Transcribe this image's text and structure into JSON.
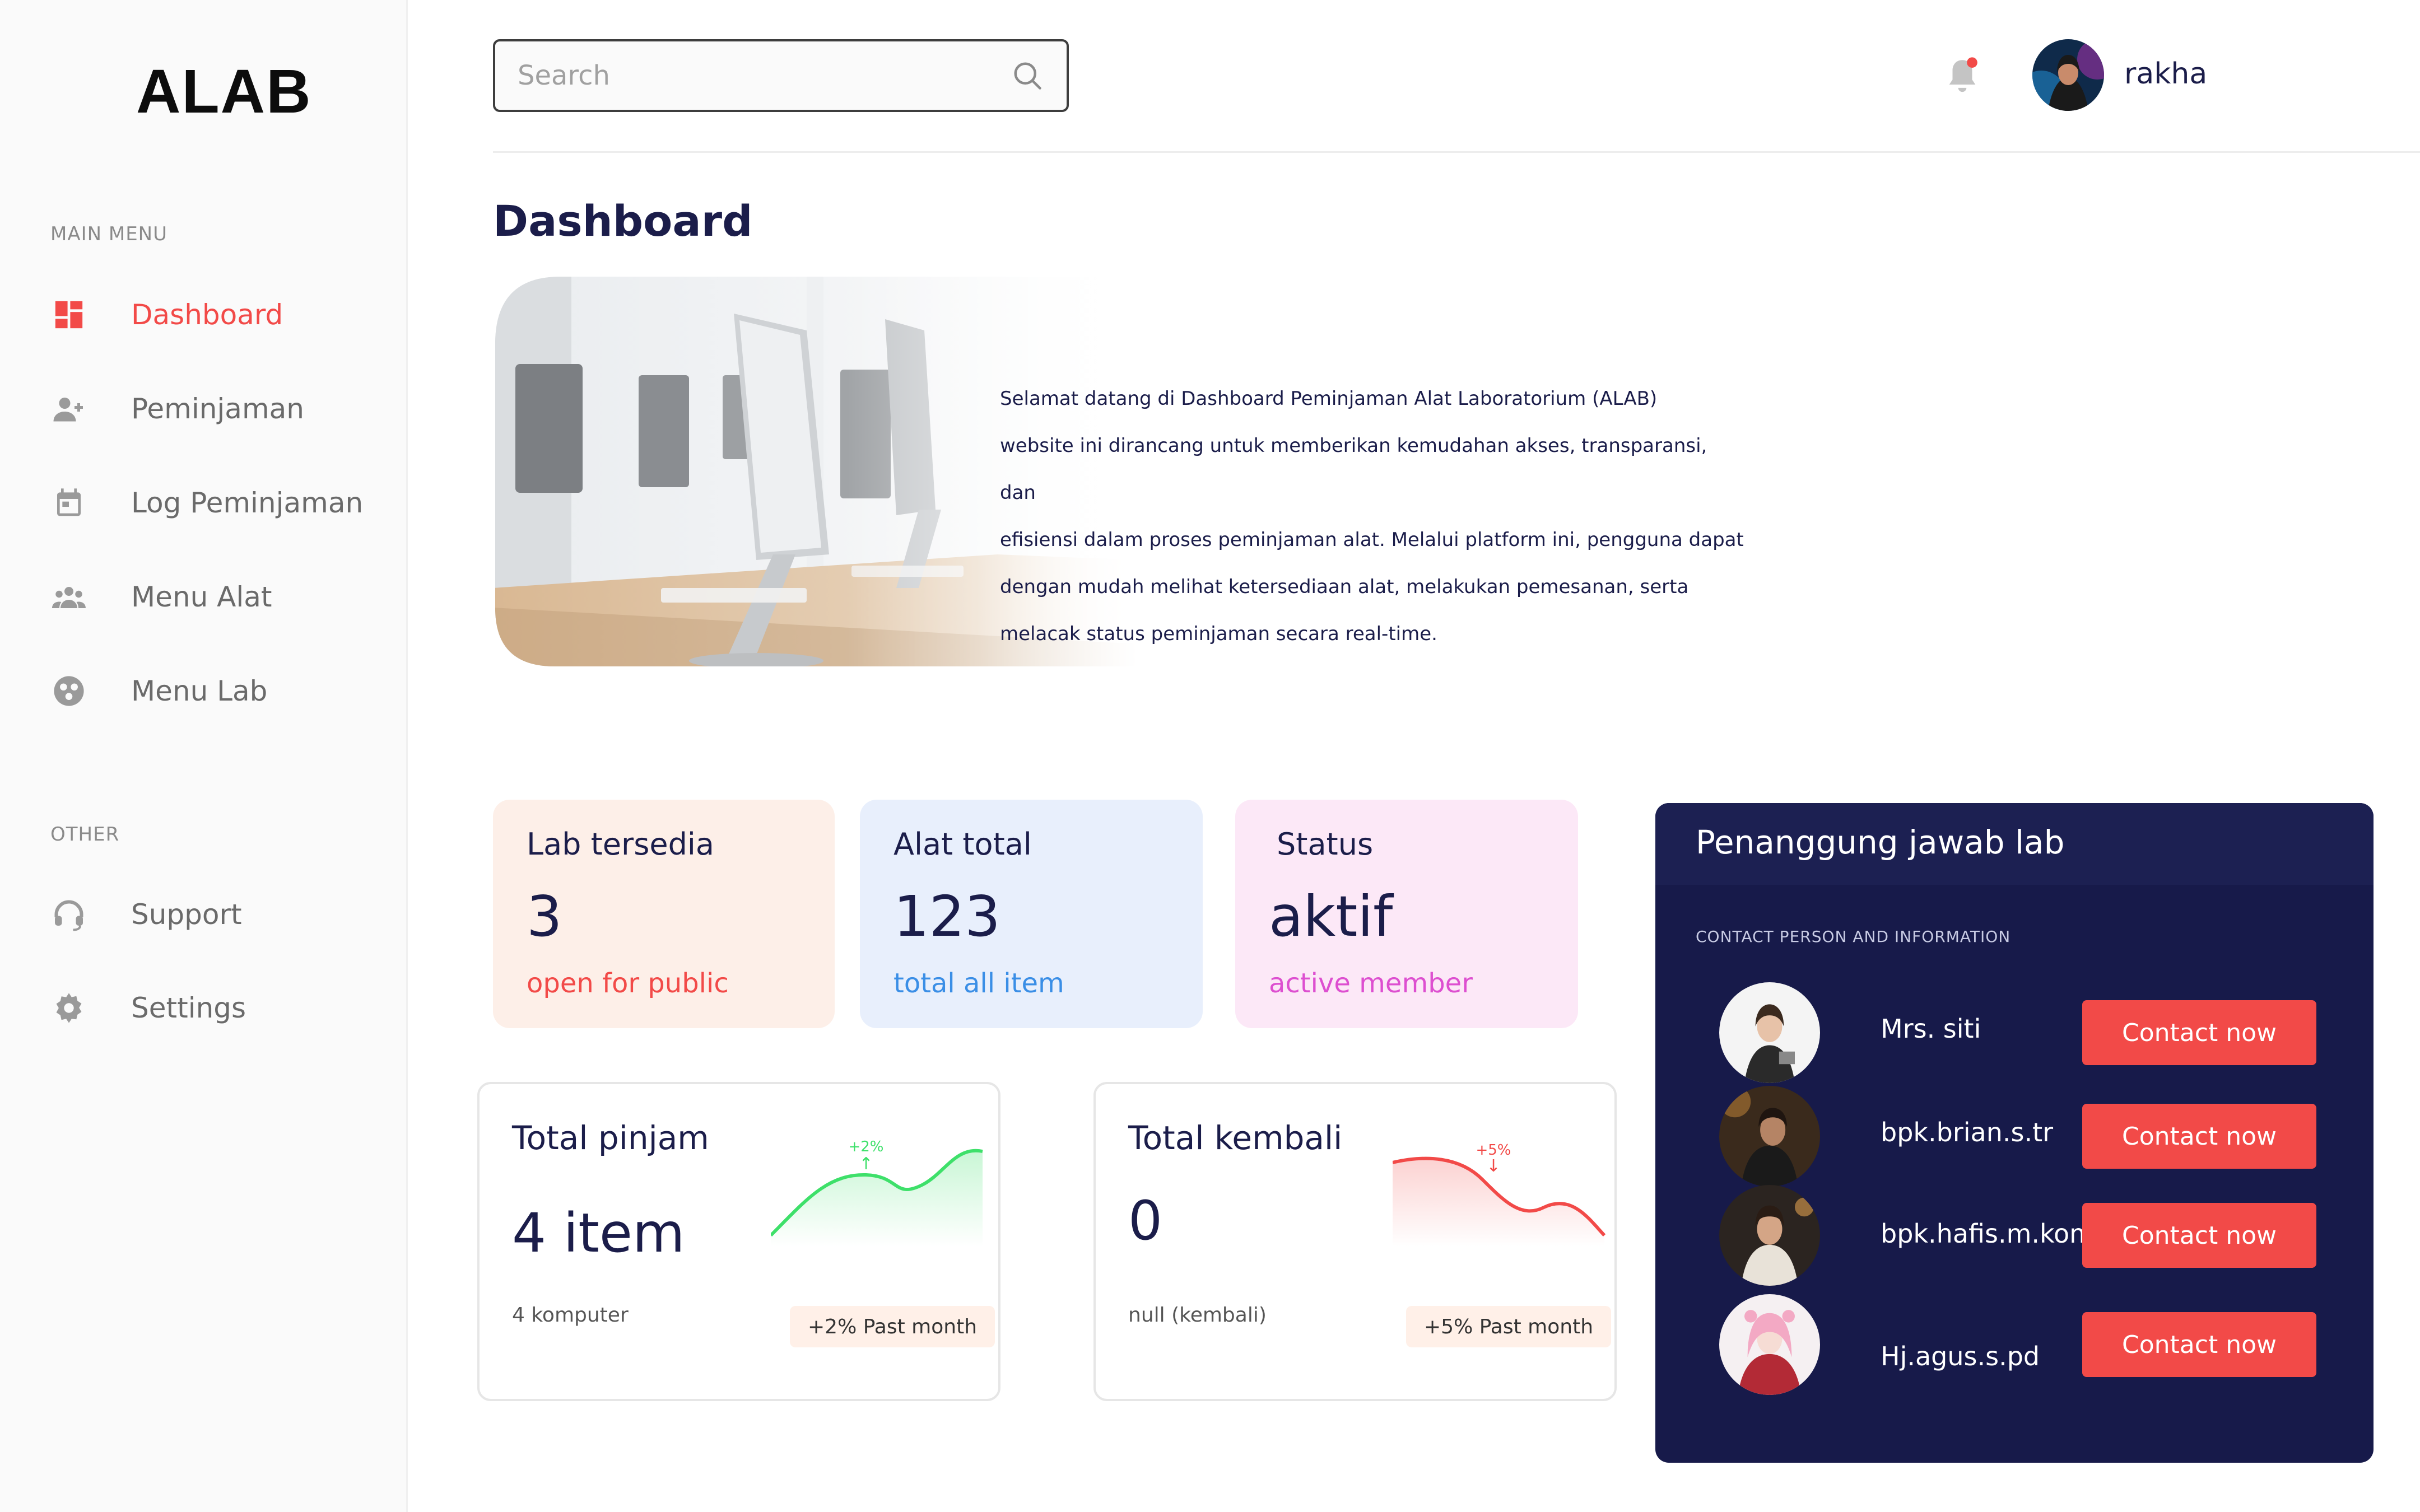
{
  "app": {
    "logo": "ALAB"
  },
  "sidebar": {
    "main_menu_label": "MAIN MENU",
    "main_items": [
      {
        "label": "Dashboard",
        "icon": "dashboard-icon",
        "active": true
      },
      {
        "label": "Peminjaman",
        "icon": "add-user-icon"
      },
      {
        "label": "Log Peminjaman",
        "icon": "calendar-icon"
      },
      {
        "label": "Menu Alat",
        "icon": "group-icon"
      },
      {
        "label": "Menu Lab",
        "icon": "lab-icon"
      }
    ],
    "other_label": "OTHER",
    "other_items": [
      {
        "label": "Support",
        "icon": "headset-icon"
      },
      {
        "label": "Settings",
        "icon": "gear-icon"
      }
    ]
  },
  "header": {
    "search_placeholder": "Search",
    "username": "rakha"
  },
  "main": {
    "title": "Dashboard",
    "hero_lines": [
      "Selamat datang di Dashboard Peminjaman Alat Laboratorium (ALAB)",
      "website ini dirancang untuk memberikan kemudahan akses, transparansi, dan",
      "efisiensi dalam proses peminjaman alat. Melalui platform ini, pengguna dapat",
      "dengan mudah melihat ketersediaan alat, melakukan pemesanan, serta",
      "melacak status peminjaman secara real-time."
    ],
    "stats": [
      {
        "title": "Lab tersedia",
        "value": "3",
        "sub": "open for public",
        "bg": "#fdefe8",
        "sub_color": "#f24a48"
      },
      {
        "title": "Alat total",
        "value": "123",
        "sub": "total all item",
        "bg": "#e8effc",
        "sub_color": "#3a8ee6"
      },
      {
        "title": "Status",
        "value": "aktif",
        "sub": "active member",
        "bg": "#fce8f7",
        "sub_color": "#dd4fd0"
      }
    ],
    "trends": [
      {
        "title": "Total pinjam",
        "value": "4  item",
        "sub": "4 komputer",
        "badge": "+2% Past month",
        "change": "+2%",
        "arrow": "↑",
        "color": "#3ee06a"
      },
      {
        "title": "Total kembali",
        "value": "0",
        "sub": "null (kembali)",
        "badge": "+5% Past month",
        "change": "+5%",
        "arrow": "↓",
        "color": "#f24a48"
      }
    ]
  },
  "panel": {
    "title": "Penanggung jawab lab",
    "subtitle": "CONTACT PERSON AND INFORMATION",
    "people": [
      {
        "name": "Mrs. siti",
        "button": "Contact now"
      },
      {
        "name": "bpk.brian.s.tr",
        "button": "Contact now"
      },
      {
        "name": "bpk.hafis.m.kom",
        "button": "Contact now"
      },
      {
        "name": "Hj.agus.s.pd",
        "button": "Contact now"
      }
    ]
  },
  "colors": {
    "accent": "#f24a48",
    "navy": "#171a4a",
    "text": "#1b1d4a"
  }
}
